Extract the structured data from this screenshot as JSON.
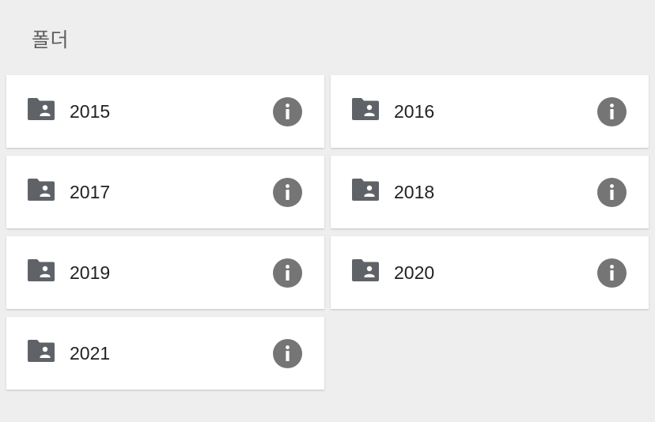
{
  "section": {
    "title": "폴더"
  },
  "folders": [
    {
      "name": "2015",
      "icon": "shared-folder-icon",
      "action_icon": "info-icon"
    },
    {
      "name": "2016",
      "icon": "shared-folder-icon",
      "action_icon": "info-icon"
    },
    {
      "name": "2017",
      "icon": "shared-folder-icon",
      "action_icon": "info-icon"
    },
    {
      "name": "2018",
      "icon": "shared-folder-icon",
      "action_icon": "info-icon"
    },
    {
      "name": "2019",
      "icon": "shared-folder-icon",
      "action_icon": "info-icon"
    },
    {
      "name": "2020",
      "icon": "shared-folder-icon",
      "action_icon": "info-icon"
    },
    {
      "name": "2021",
      "icon": "shared-folder-icon",
      "action_icon": "info-icon"
    }
  ],
  "colors": {
    "background": "#eeeeee",
    "card": "#ffffff",
    "icon": "#5f6368",
    "info": "#757575",
    "title": "#5f5f5f"
  }
}
